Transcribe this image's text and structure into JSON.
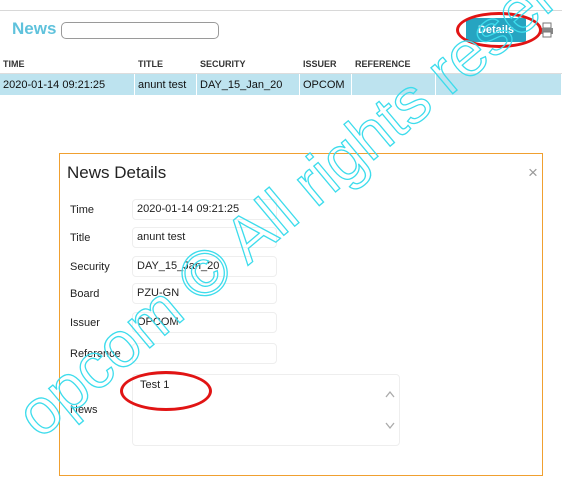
{
  "header": {
    "title": "News",
    "search_value": "",
    "details_label": "Details"
  },
  "table": {
    "columns": [
      "TIME",
      "TITLE",
      "SECURITY",
      "ISSUER",
      "REFERENCE",
      ""
    ],
    "rows": [
      [
        "2020-01-14 09:21:25",
        "anunt test",
        "DAY_15_Jan_20",
        "OPCOM",
        "",
        ""
      ]
    ]
  },
  "dialog": {
    "title": "News Details",
    "close_glyph": "×",
    "fields": {
      "time": {
        "label": "Time",
        "value": "2020-01-14 09:21:25"
      },
      "title": {
        "label": "Title",
        "value": "anunt test"
      },
      "security": {
        "label": "Security",
        "value": "DAY_15_Jan_20"
      },
      "board": {
        "label": "Board",
        "value": "PZU-GN"
      },
      "issuer": {
        "label": "Issuer",
        "value": "OPCOM"
      },
      "reference": {
        "label": "Reference",
        "value": ""
      },
      "news": {
        "label": "News",
        "value": "Test 1"
      }
    }
  },
  "watermark": {
    "text": "opcom © All rights reserved"
  },
  "colors": {
    "accent": "#26a4c1",
    "title_blue": "#5fc2dc",
    "selected_row": "#bde3ef",
    "dialog_border": "#f0a030",
    "highlight_red": "#e11414",
    "watermark": "#3ddcec"
  }
}
